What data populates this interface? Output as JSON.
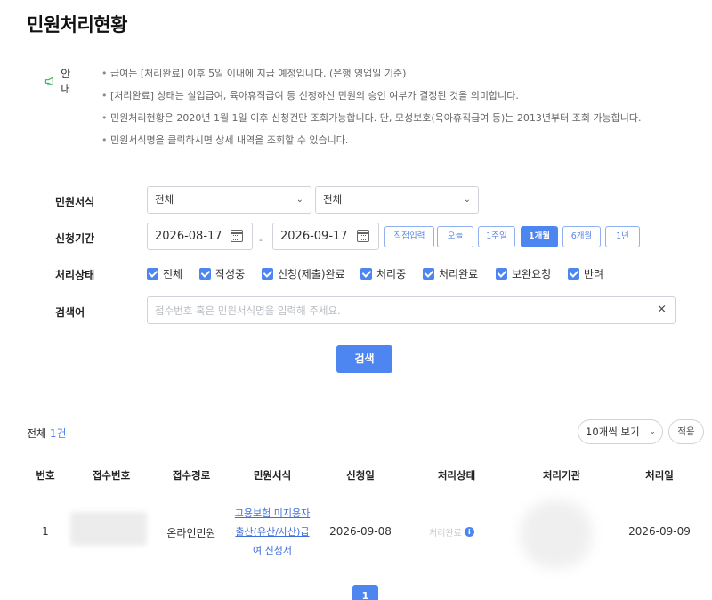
{
  "page": {
    "title": "민원처리현황"
  },
  "notice": {
    "label": "안내",
    "items": [
      "급여는 [처리완료] 이후 5일 이내에 지급 예정입니다. (은행 영업일 기준)",
      "[처리완료] 상태는 실업급여, 육아휴직급여 등 신청하신 민원의 승인 여부가 결정된 것을 의미합니다.",
      "민원처리현황은 2020년 1월 1일 이후 신청건만 조회가능합니다. 단, 모성보호(육아휴직급여 등)는 2013년부터 조회 가능합니다.",
      "민원서식명을 클릭하시면 상세 내역을 조회할 수 있습니다."
    ]
  },
  "form": {
    "type_label": "민원서식",
    "type_select_1": "전체",
    "type_select_2": "전체",
    "period_label": "신청기간",
    "date_from": "2026-08-17",
    "date_to": "2026-09-17",
    "date_sep": "-",
    "period_buttons": [
      "직접입력",
      "오늘",
      "1주일",
      "1개월",
      "6개월",
      "1년"
    ],
    "period_active": "1개월",
    "status_label": "처리상태",
    "status_options": [
      "전체",
      "작성중",
      "신청(제출)완료",
      "처리중",
      "처리완료",
      "보완요청",
      "반려"
    ],
    "keyword_label": "검색어",
    "keyword_placeholder": "접수번호 혹은 민원서식명을 입력해 주세요.",
    "clear_symbol": "×",
    "search_button": "검색"
  },
  "results": {
    "total_prefix": "전체 ",
    "total_count": "1건",
    "page_size": "10개씩 보기",
    "apply_button": "적용",
    "columns": [
      "번호",
      "접수번호",
      "접수경로",
      "민원서식",
      "신청일",
      "처리상태",
      "처리기관",
      "처리일"
    ],
    "rows": [
      {
        "no": "1",
        "route": "온라인민원",
        "form_lines": [
          "고용보험 미지용자",
          "출산(유산/사산)급",
          "여 신청서"
        ],
        "applied": "2026-09-08",
        "status": "처리완료",
        "processed": "2026-09-09"
      }
    ],
    "pagination_current": "1"
  },
  "colors": {
    "accent": "#4d86f0",
    "link": "#3f6fd8"
  },
  "icons": {
    "notice": "megaphone-icon",
    "calendar": "calendar-icon",
    "info": "info-icon"
  }
}
